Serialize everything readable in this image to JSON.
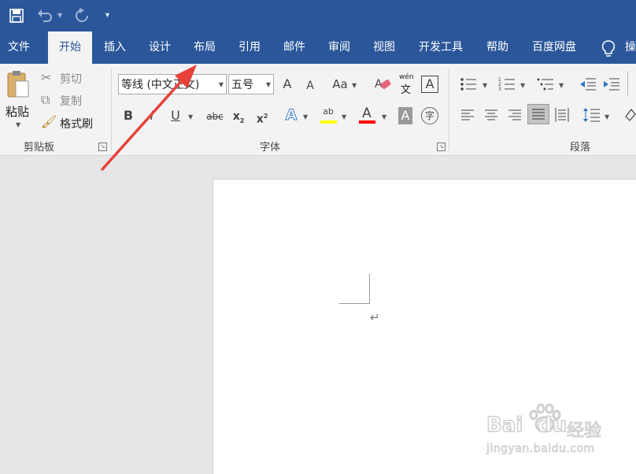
{
  "qat": {
    "save_icon": "save-icon",
    "undo_icon": "undo-icon",
    "redo_icon": "redo-icon",
    "customize_icon": "customize-qat-icon"
  },
  "tabs": [
    {
      "label": "文件"
    },
    {
      "label": "开始"
    },
    {
      "label": "插入"
    },
    {
      "label": "设计"
    },
    {
      "label": "布局"
    },
    {
      "label": "引用"
    },
    {
      "label": "邮件"
    },
    {
      "label": "审阅"
    },
    {
      "label": "视图"
    },
    {
      "label": "开发工具"
    },
    {
      "label": "帮助"
    },
    {
      "label": "百度网盘"
    },
    {
      "label": "操"
    }
  ],
  "clipboard": {
    "paste": "粘贴",
    "cut": "剪切",
    "copy": "复制",
    "format_painter": "格式刷",
    "group_label": "剪贴板"
  },
  "font": {
    "font_name": "等线 (中文正文)",
    "font_size": "五号",
    "grow": "A",
    "shrink": "A",
    "change_case": "Aa",
    "phonetic_top": "wén",
    "phonetic_bottom": "文",
    "char_border": "A",
    "bold": "B",
    "italic": "I",
    "underline": "U",
    "strike": "abc",
    "subscript": "x",
    "subscript_mark": "2",
    "superscript": "x",
    "superscript_mark": "2",
    "text_effects": "A",
    "highlight": "ab",
    "font_color": "A",
    "char_shading": "A",
    "enclose": "字",
    "group_label": "字体"
  },
  "paragraph": {
    "group_label": "段落"
  },
  "colors": {
    "title_bar": "#2b579a",
    "highlight_yellow": "#ffff00",
    "font_color_red": "#ff0000",
    "annotation_arrow": "#e8413c"
  },
  "document": {
    "return_mark": "↵"
  },
  "watermark": {
    "brand": "Bai",
    "brand_suffix": "du",
    "brand_cn": "经验",
    "url": "jingyan.baidu.com"
  }
}
